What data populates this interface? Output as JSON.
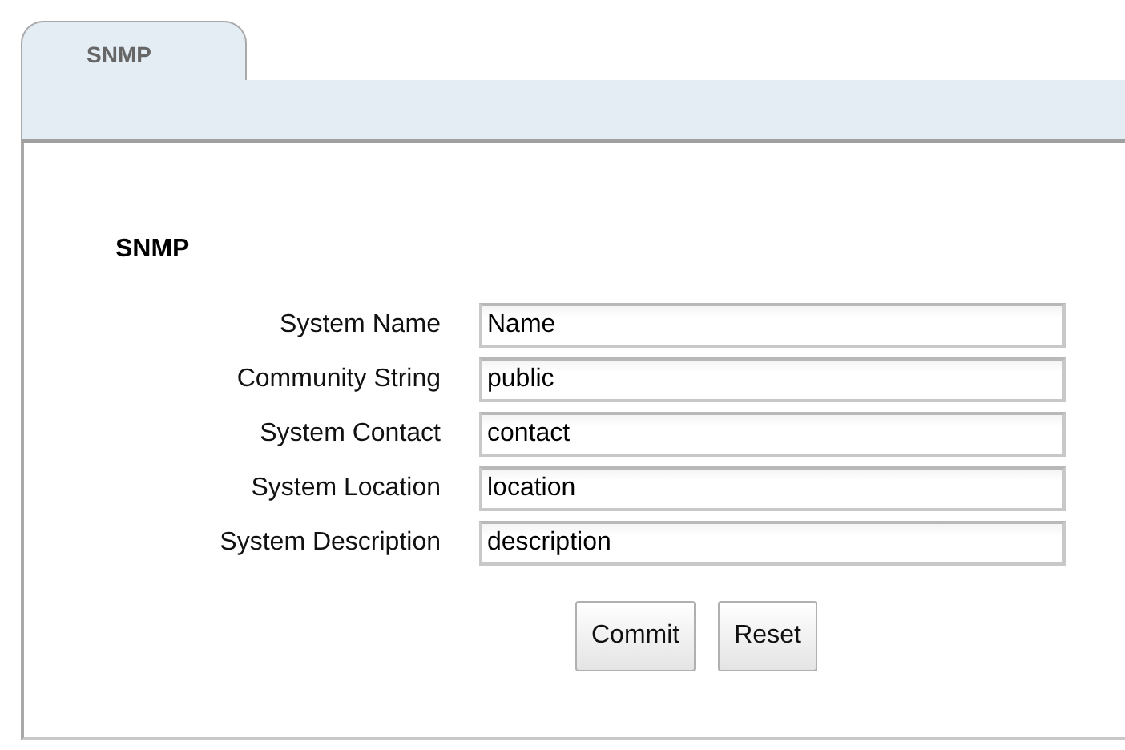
{
  "tabs": [
    {
      "label": "SNMP",
      "selected": true
    }
  ],
  "section": {
    "heading": "SNMP"
  },
  "fields": [
    {
      "label": "System Name",
      "value": "Name"
    },
    {
      "label": "Community String",
      "value": "public"
    },
    {
      "label": "System Contact",
      "value": "contact"
    },
    {
      "label": "System Location",
      "value": "location"
    },
    {
      "label": "System Description",
      "value": "description"
    }
  ],
  "buttons": [
    "Commit",
    "Reset"
  ]
}
